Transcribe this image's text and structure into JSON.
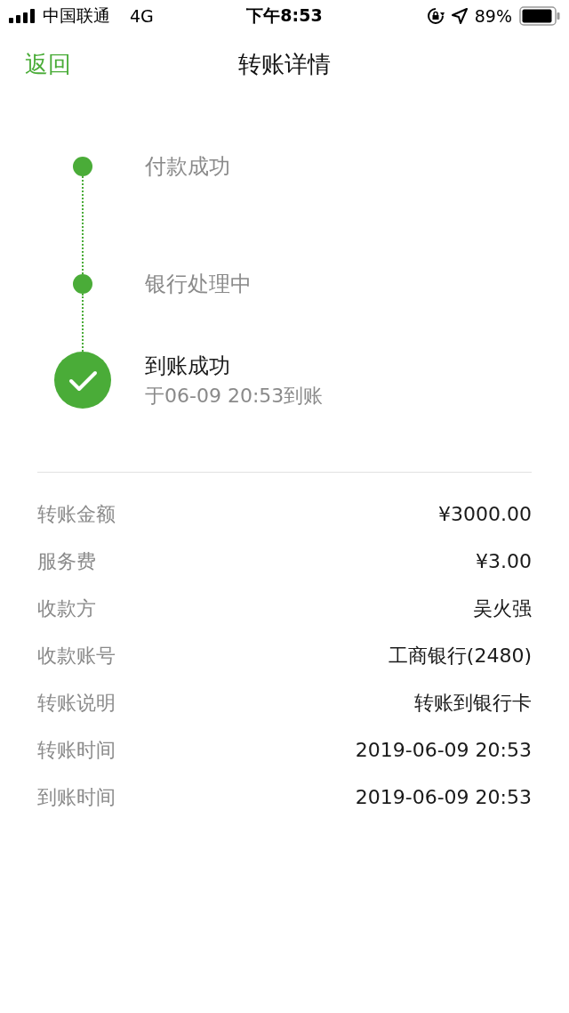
{
  "status_bar": {
    "carrier": "中国联通",
    "network": "4G",
    "time": "下午8:53",
    "battery": "89%"
  },
  "nav": {
    "back": "返回",
    "title": "转账详情"
  },
  "steps": [
    {
      "kind": "dot",
      "title": "付款成功"
    },
    {
      "kind": "dot",
      "title": "银行处理中"
    },
    {
      "kind": "check",
      "title": "到账成功",
      "note": "于06-09 20:53到账"
    }
  ],
  "details": [
    {
      "label": "转账金额",
      "value": "¥3000.00"
    },
    {
      "label": "服务费",
      "value": "¥3.00"
    },
    {
      "label": "收款方",
      "value": "吴火强"
    },
    {
      "label": "收款账号",
      "value": "工商银行(2480)"
    },
    {
      "label": "转账说明",
      "value": "转账到银行卡"
    },
    {
      "label": "转账时间",
      "value": "2019-06-09 20:53"
    },
    {
      "label": "到账时间",
      "value": "2019-06-09 20:53"
    }
  ]
}
